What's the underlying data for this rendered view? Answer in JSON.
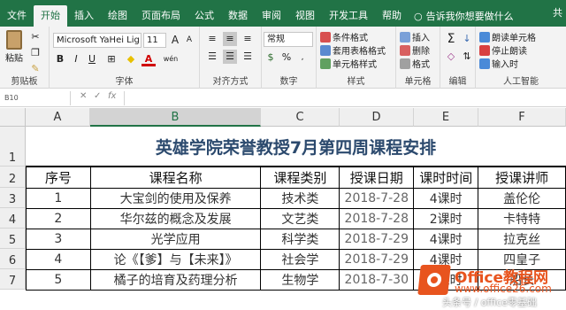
{
  "menubar": {
    "tabs": [
      "文件",
      "开始",
      "插入",
      "绘图",
      "页面布局",
      "公式",
      "数据",
      "审阅",
      "视图",
      "开发工具",
      "帮助"
    ],
    "active_index": 1,
    "tellme": "告诉我你想要做什么",
    "share": "共"
  },
  "ribbon": {
    "clipboard": {
      "label": "剪贴板",
      "paste": "粘贴"
    },
    "font": {
      "label": "字体",
      "name": "Microsoft YaHei Lig",
      "size": "11",
      "bold": "B",
      "italic": "I",
      "underline": "U",
      "grow": "A",
      "shrink": "A",
      "color_a": "A",
      "wen": "wén"
    },
    "alignment": {
      "label": "对齐方式"
    },
    "number": {
      "label": "数字",
      "format": "常规",
      "percent": "%"
    },
    "styles": {
      "label": "样式",
      "cond": "条件格式",
      "table": "套用表格格式",
      "cell": "单元格样式"
    },
    "cells": {
      "label": "单元格",
      "insert": "插入",
      "delete": "删除",
      "format": "格式"
    },
    "edit": {
      "label": "编辑"
    },
    "ai": {
      "label": "人工智能",
      "read_cell": "朗读单元格",
      "stop": "停止朗读",
      "enter": "输入时"
    }
  },
  "formula_bar": {
    "name_box": "B10",
    "fx": "fx"
  },
  "sheet": {
    "columns": [
      "A",
      "B",
      "C",
      "D",
      "E",
      "F"
    ],
    "selected_column": "B",
    "rows": [
      "1",
      "2",
      "3",
      "4",
      "5",
      "6",
      "7"
    ],
    "title": "英雄学院荣誉教授7月第四周课程安排",
    "headers": [
      "序号",
      "课程名称",
      "课程类别",
      "授课日期",
      "课时时间",
      "授课讲师"
    ],
    "data": [
      [
        "1",
        "大宝剑的使用及保养",
        "技术类",
        "2018-7-28",
        "4课时",
        "盖伦伦"
      ],
      [
        "2",
        "华尔兹的概念及发展",
        "文艺类",
        "2018-7-28",
        "2课时",
        "卡特特"
      ],
      [
        "3",
        "光学应用",
        "科学类",
        "2018-7-29",
        "4课时",
        "拉克丝"
      ],
      [
        "4",
        "论《【爹】与【未来】》",
        "社会学",
        "2018-7-29",
        "4课时",
        "四皇子"
      ],
      [
        "5",
        "橘子的培育及药理分析",
        "生物学",
        "2018-7-30",
        "2课时",
        "船长"
      ]
    ]
  },
  "watermark": {
    "brand": "Office教程网",
    "url": "www.office26.com",
    "credit": "头条号 / office零基础"
  },
  "colors": {
    "excel_green": "#217346",
    "title_blue": "#2c4a6e",
    "brand_orange": "#e8541e"
  }
}
